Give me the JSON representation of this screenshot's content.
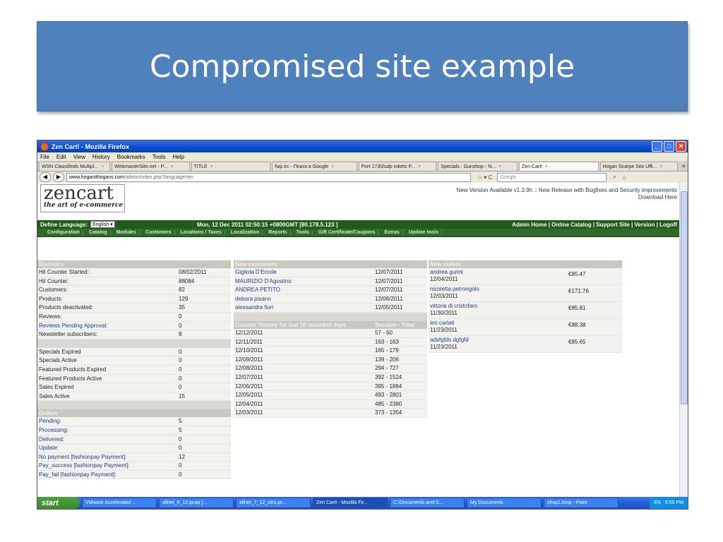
{
  "slide": {
    "title": "Compromised site example"
  },
  "browser": {
    "window_title": "Zen Cart! - Mozilla Firefox",
    "menu": [
      "File",
      "Edit",
      "View",
      "History",
      "Bookmarks",
      "Tools",
      "Help"
    ],
    "tabs": [
      "WSN Classifieds Multipl...",
      "WebmasterSite.net - P...",
      "TITLE",
      "fwp irc - Поиск в Google",
      "Port 1730/udp roketz P...",
      "Specials : Gunshop - N...",
      "Zen Cart!",
      "Hogan Scarpe Sito Uffi..."
    ],
    "url_domain": "www.hoganithogans.com",
    "url_path": "/admin/index.php?language=en",
    "search_placeholder": "Google"
  },
  "header": {
    "logo_big": "zencart",
    "logo_small": "the art of e-commerce",
    "new_version": "New Version Available v1.3.9h :: New Release with Bugfixes and Security improvements",
    "download": "Download Here",
    "define_language": "Define Language:",
    "language_value": "English",
    "date": "Mon, 12 Dec 2011 02:50:15 +0800GMT [80.178.5.123 ]",
    "admin_links": "Admin Home | Online Catalog | Support Site | Version | Logoff",
    "menu": [
      "Configuration",
      "Catalog",
      "Modules",
      "Customers",
      "Locations / Taxes",
      "Localization",
      "Reports",
      "Tools",
      "Gift Certificate/Coupons",
      "Extras",
      "Update tools"
    ]
  },
  "statistics": {
    "title": "Statistics",
    "rows": [
      {
        "k": "Hit Counter Started:",
        "v": "08/02/2011"
      },
      {
        "k": "Hit Counter:",
        "v": "88084"
      },
      {
        "k": "Customers:",
        "v": "82"
      },
      {
        "k": "Products:",
        "v": "129"
      },
      {
        "k": "Products deactivated:",
        "v": "35"
      },
      {
        "k": "Reviews:",
        "v": "0"
      },
      {
        "k": "Reviews Pending Approval:",
        "v": "0"
      },
      {
        "k": "Newsletter subscribers:",
        "v": "8"
      }
    ],
    "rows2": [
      {
        "k": "Specials Expired",
        "v": "0"
      },
      {
        "k": "Specials Active",
        "v": "0"
      },
      {
        "k": "Featured Products Expired",
        "v": "0"
      },
      {
        "k": "Featured Products Active",
        "v": "0"
      },
      {
        "k": "Sales Expired",
        "v": "0"
      },
      {
        "k": "Sales Active",
        "v": "15"
      }
    ]
  },
  "orders_status": {
    "title": "Orders",
    "rows": [
      {
        "k": "Pending:",
        "v": "5"
      },
      {
        "k": "Processing:",
        "v": "5"
      },
      {
        "k": "Delivered:",
        "v": "0"
      },
      {
        "k": "Update:",
        "v": "0"
      },
      {
        "k": "No payment [fashionpay Payment]:",
        "v": "12"
      },
      {
        "k": "Pay_success [fashionpay Payment]:",
        "v": "0"
      },
      {
        "k": "Pay_fail [fashionpay Payment]:",
        "v": "0"
      }
    ]
  },
  "new_customers": {
    "title": "New customers:",
    "rows": [
      {
        "k": "Gigliola D'Ercole",
        "v": "12/07/2011"
      },
      {
        "k": "MAURIZIO D'Agostino",
        "v": "12/07/2011"
      },
      {
        "k": "ANDREA PETITO",
        "v": "12/07/2011"
      },
      {
        "k": "debora pisano",
        "v": "12/06/2011"
      },
      {
        "k": "alessandra fiori",
        "v": "12/05/2011"
      }
    ]
  },
  "counter_history": {
    "title": "Counter History for last 10 recorded days",
    "col2": "Session - Total",
    "rows": [
      {
        "k": "12/12/2011",
        "v": "57 - 60"
      },
      {
        "k": "12/11/2011",
        "v": "163 - 163"
      },
      {
        "k": "12/10/2011",
        "v": "165 - 179"
      },
      {
        "k": "12/09/2011",
        "v": "139 - 206"
      },
      {
        "k": "12/08/2011",
        "v": "294 - 727"
      },
      {
        "k": "12/07/2011",
        "v": "392 - 1524"
      },
      {
        "k": "12/06/2011",
        "v": "395 - 1884"
      },
      {
        "k": "12/05/2011",
        "v": "493 - 2801"
      },
      {
        "k": "12/04/2011",
        "v": "485 - 2380"
      },
      {
        "k": "12/03/2011",
        "v": "373 - 1354"
      }
    ]
  },
  "new_orders": {
    "title": "New orders:",
    "rows": [
      {
        "name": "andrea gurini",
        "date": "12/04/2011",
        "amount": "€85.47"
      },
      {
        "name": "nicoletta petrongolo",
        "date": "12/03/2011",
        "amount": "€171.76"
      },
      {
        "name": "vittoria di cristofaro",
        "date": "11/30/2011",
        "amount": "€85.81"
      },
      {
        "name": "leo cariati",
        "date": "11/23/2011",
        "amount": "€88.38"
      },
      {
        "name": "adsfgfds dgfgfd",
        "date": "11/23/2011",
        "amount": "€85.65"
      }
    ]
  },
  "taskbar": {
    "start": "start",
    "tasks": [
      "VMware Accelerated ...",
      "allnet_6_12.pcap [...",
      "allnet_7_12_utro.pc...",
      "Zen Cart! - Mozilla Fir...",
      "C:\\Documents and S...",
      "My Documents",
      "shop1.bmp - Paint"
    ],
    "lang": "EN",
    "time": "8:50 PM"
  }
}
